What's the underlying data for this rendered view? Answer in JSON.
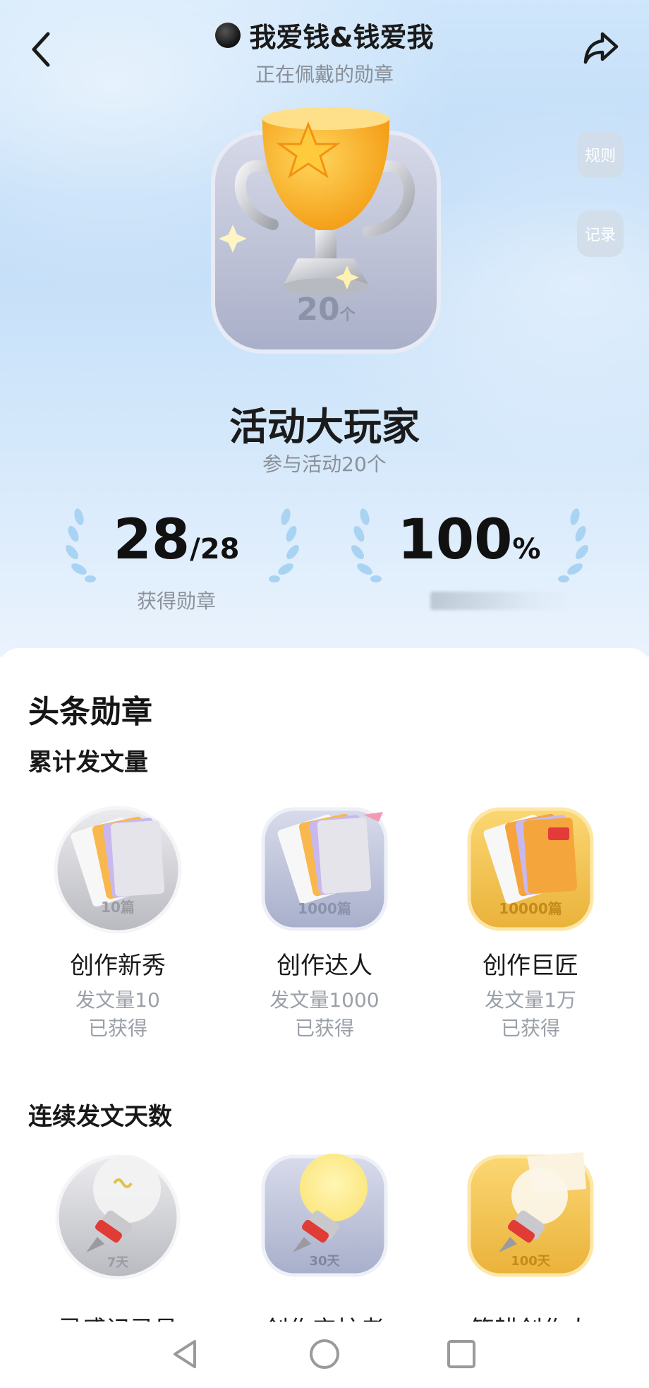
{
  "header": {
    "title": "我爱钱&钱爱我",
    "subtitle": "正在佩戴的勋章"
  },
  "side_buttons": {
    "rules": "规则",
    "records": "记录"
  },
  "current_badge": {
    "count": "20",
    "unit": "个",
    "name": "活动大玩家",
    "description": "参与活动20个"
  },
  "stats": {
    "earned_value": "28",
    "earned_total": "/28",
    "earned_label": "获得勋章",
    "percent_value": "100",
    "percent_unit": "%"
  },
  "section": {
    "title": "头条勋章"
  },
  "groups": [
    {
      "title": "累计发文量",
      "items": [
        {
          "name": "创作新秀",
          "badge_label": "10篇",
          "desc": "发文量10",
          "status": "已获得",
          "tier": "silver"
        },
        {
          "name": "创作达人",
          "badge_label": "1000篇",
          "desc": "发文量1000",
          "status": "已获得",
          "tier": "lavender"
        },
        {
          "name": "创作巨匠",
          "badge_label": "10000篇",
          "desc": "发文量1万",
          "status": "已获得",
          "tier": "gold"
        }
      ]
    },
    {
      "title": "连续发文天数",
      "items": [
        {
          "name": "灵感记录员",
          "badge_label": "7天",
          "tier": "silver"
        },
        {
          "name": "创作守护者",
          "badge_label": "30天",
          "tier": "lavender"
        },
        {
          "name": "笔耕创作人",
          "badge_label": "100天",
          "tier": "gold"
        }
      ]
    }
  ],
  "colors": {
    "hero_top": "#cfe6fb",
    "gold": "#f3c24a",
    "silver": "#cfd0d4",
    "lavender": "#b7bed8"
  }
}
